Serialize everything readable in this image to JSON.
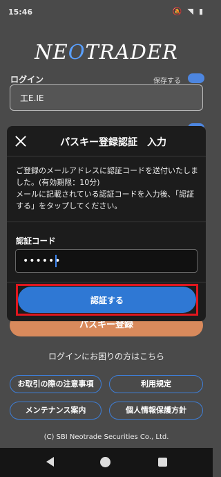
{
  "status_bar": {
    "time": "15:46"
  },
  "logo": {
    "pre": "NE",
    "o": "O",
    "post": "TRADER"
  },
  "background": {
    "login_label": "ログイン",
    "save_label": "保存する",
    "login_value": "工E.IE",
    "register_button": "パスキー登録",
    "help_link": "ログインにお困りの方はこちら",
    "links": [
      "お取引の際の注意事項",
      "利用規定",
      "メンテナンス案内",
      "個人情報保護方針"
    ],
    "copyright": "(C) SBI Neotrade Securities Co., Ltd."
  },
  "modal": {
    "title": "パスキー登録認証　入力",
    "message_line1": "ご登録のメールアドレスに認証コードを送付いたしました。(有効期限：10分)",
    "message_line2": "メールに記載されている認証コードを入力後、「認証する」をタップしてください。",
    "code_label": "認証コード",
    "code_value": "••••••",
    "submit_button": "認証する"
  },
  "colors": {
    "accent": "#2f78d4",
    "highlight": "#e0161e",
    "orange": "#d98a5c"
  }
}
